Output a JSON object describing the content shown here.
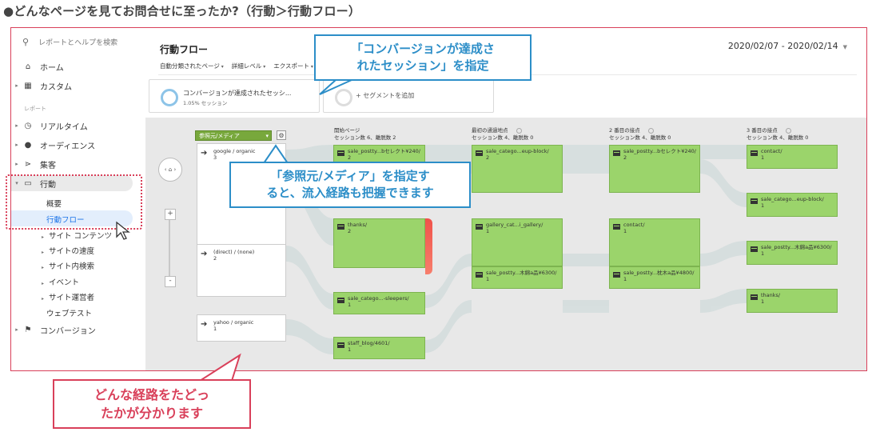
{
  "heading": "●どんなページを見てお問合せに至ったか?（行動＞行動フロー）",
  "sidebar": {
    "search_text": "レポートとヘルプを検索",
    "home": "ホーム",
    "custom": "カスタム",
    "section_label": "レポート",
    "realtime": "リアルタイム",
    "audience": "オーディエンス",
    "acquisition": "集客",
    "behavior": "行動",
    "overview": "概要",
    "behavior_flow": "行動フロー",
    "site_content": "サイト コンテンツ",
    "site_speed": "サイトの速度",
    "site_search": "サイト内検索",
    "events": "イベント",
    "publisher": "サイト運営者",
    "experiments": "ウェブテスト",
    "conversions": "コンバージョン"
  },
  "main": {
    "title": "行動フロー",
    "date_range": "2020/02/07 - 2020/02/14",
    "toolbar": [
      "自動分類されたページ",
      "詳細レベル",
      "エクスポート"
    ],
    "segment_title": "コンバージョンが達成されたセッシ...",
    "segment_sub": "1.05% セッション",
    "segment_add": "+ セグメントを追加",
    "dimension": "参照元/メディア",
    "zoom_pan": "‹ ⌂ ›",
    "zoom_plus": "+",
    "zoom_minus": "-"
  },
  "columns": [
    {
      "title": "開始ページ",
      "stats": "セッション数 6、離脱数 2"
    },
    {
      "title": "最初の通過地点",
      "stats": "セッション数 4、離脱数 0"
    },
    {
      "title": "2 番目の接点",
      "stats": "セッション数 4、離脱数 0"
    },
    {
      "title": "3 番目の接点",
      "stats": "セッション数 4、離脱数 0"
    }
  ],
  "sources": [
    {
      "name": "google / organic",
      "count": "3"
    },
    {
      "name": "(direct) / (none)",
      "count": "2"
    },
    {
      "name": "yahoo / organic",
      "count": "1"
    }
  ],
  "nodes": {
    "c1": [
      {
        "name": "sale_postty...bセレクト¥240/",
        "count": "2"
      },
      {
        "name": "thanks/",
        "count": "2"
      },
      {
        "name": "sale_catego...-sleepers/",
        "count": "1"
      },
      {
        "name": "staff_blog/4601/",
        "count": "1"
      }
    ],
    "c2": [
      {
        "name": "sale_catego...eup-block/",
        "count": "2"
      },
      {
        "name": "gallery_cat...i_gallery/",
        "count": "1"
      },
      {
        "name": "sale_postty...木綿a品¥6300/",
        "count": "1"
      }
    ],
    "c3": [
      {
        "name": "sale_postty...bセレクト¥240/",
        "count": "2"
      },
      {
        "name": "contact/",
        "count": "1"
      },
      {
        "name": "sale_postty...枕木a品¥4800/",
        "count": "1"
      }
    ],
    "c4": [
      {
        "name": "contact/",
        "count": "1"
      },
      {
        "name": "sale_catego...eup-block/",
        "count": "1"
      },
      {
        "name": "sale_postty...木綿a品¥6300/",
        "count": "1"
      },
      {
        "name": "thanks/",
        "count": "1"
      }
    ]
  },
  "callouts": {
    "blue1": [
      "「コンバージョンが達成さ",
      "れたセッション」を指定"
    ],
    "blue2": [
      "「参照元/メディア」を指定す",
      "ると、流入経路も把握できます"
    ],
    "red": [
      "どんな経路をたどっ",
      "たかが分かります"
    ]
  }
}
